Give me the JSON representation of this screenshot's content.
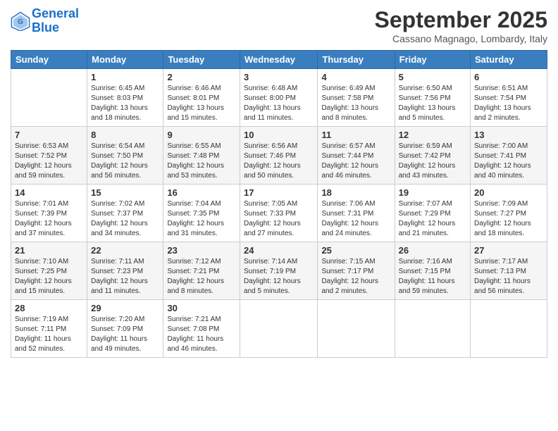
{
  "header": {
    "logo_line1": "General",
    "logo_line2": "Blue",
    "month_title": "September 2025",
    "location": "Cassano Magnago, Lombardy, Italy"
  },
  "days_of_week": [
    "Sunday",
    "Monday",
    "Tuesday",
    "Wednesday",
    "Thursday",
    "Friday",
    "Saturday"
  ],
  "weeks": [
    [
      {
        "day": "",
        "info": ""
      },
      {
        "day": "1",
        "info": "Sunrise: 6:45 AM\nSunset: 8:03 PM\nDaylight: 13 hours\nand 18 minutes."
      },
      {
        "day": "2",
        "info": "Sunrise: 6:46 AM\nSunset: 8:01 PM\nDaylight: 13 hours\nand 15 minutes."
      },
      {
        "day": "3",
        "info": "Sunrise: 6:48 AM\nSunset: 8:00 PM\nDaylight: 13 hours\nand 11 minutes."
      },
      {
        "day": "4",
        "info": "Sunrise: 6:49 AM\nSunset: 7:58 PM\nDaylight: 13 hours\nand 8 minutes."
      },
      {
        "day": "5",
        "info": "Sunrise: 6:50 AM\nSunset: 7:56 PM\nDaylight: 13 hours\nand 5 minutes."
      },
      {
        "day": "6",
        "info": "Sunrise: 6:51 AM\nSunset: 7:54 PM\nDaylight: 13 hours\nand 2 minutes."
      }
    ],
    [
      {
        "day": "7",
        "info": "Sunrise: 6:53 AM\nSunset: 7:52 PM\nDaylight: 12 hours\nand 59 minutes."
      },
      {
        "day": "8",
        "info": "Sunrise: 6:54 AM\nSunset: 7:50 PM\nDaylight: 12 hours\nand 56 minutes."
      },
      {
        "day": "9",
        "info": "Sunrise: 6:55 AM\nSunset: 7:48 PM\nDaylight: 12 hours\nand 53 minutes."
      },
      {
        "day": "10",
        "info": "Sunrise: 6:56 AM\nSunset: 7:46 PM\nDaylight: 12 hours\nand 50 minutes."
      },
      {
        "day": "11",
        "info": "Sunrise: 6:57 AM\nSunset: 7:44 PM\nDaylight: 12 hours\nand 46 minutes."
      },
      {
        "day": "12",
        "info": "Sunrise: 6:59 AM\nSunset: 7:42 PM\nDaylight: 12 hours\nand 43 minutes."
      },
      {
        "day": "13",
        "info": "Sunrise: 7:00 AM\nSunset: 7:41 PM\nDaylight: 12 hours\nand 40 minutes."
      }
    ],
    [
      {
        "day": "14",
        "info": "Sunrise: 7:01 AM\nSunset: 7:39 PM\nDaylight: 12 hours\nand 37 minutes."
      },
      {
        "day": "15",
        "info": "Sunrise: 7:02 AM\nSunset: 7:37 PM\nDaylight: 12 hours\nand 34 minutes."
      },
      {
        "day": "16",
        "info": "Sunrise: 7:04 AM\nSunset: 7:35 PM\nDaylight: 12 hours\nand 31 minutes."
      },
      {
        "day": "17",
        "info": "Sunrise: 7:05 AM\nSunset: 7:33 PM\nDaylight: 12 hours\nand 27 minutes."
      },
      {
        "day": "18",
        "info": "Sunrise: 7:06 AM\nSunset: 7:31 PM\nDaylight: 12 hours\nand 24 minutes."
      },
      {
        "day": "19",
        "info": "Sunrise: 7:07 AM\nSunset: 7:29 PM\nDaylight: 12 hours\nand 21 minutes."
      },
      {
        "day": "20",
        "info": "Sunrise: 7:09 AM\nSunset: 7:27 PM\nDaylight: 12 hours\nand 18 minutes."
      }
    ],
    [
      {
        "day": "21",
        "info": "Sunrise: 7:10 AM\nSunset: 7:25 PM\nDaylight: 12 hours\nand 15 minutes."
      },
      {
        "day": "22",
        "info": "Sunrise: 7:11 AM\nSunset: 7:23 PM\nDaylight: 12 hours\nand 11 minutes."
      },
      {
        "day": "23",
        "info": "Sunrise: 7:12 AM\nSunset: 7:21 PM\nDaylight: 12 hours\nand 8 minutes."
      },
      {
        "day": "24",
        "info": "Sunrise: 7:14 AM\nSunset: 7:19 PM\nDaylight: 12 hours\nand 5 minutes."
      },
      {
        "day": "25",
        "info": "Sunrise: 7:15 AM\nSunset: 7:17 PM\nDaylight: 12 hours\nand 2 minutes."
      },
      {
        "day": "26",
        "info": "Sunrise: 7:16 AM\nSunset: 7:15 PM\nDaylight: 11 hours\nand 59 minutes."
      },
      {
        "day": "27",
        "info": "Sunrise: 7:17 AM\nSunset: 7:13 PM\nDaylight: 11 hours\nand 56 minutes."
      }
    ],
    [
      {
        "day": "28",
        "info": "Sunrise: 7:19 AM\nSunset: 7:11 PM\nDaylight: 11 hours\nand 52 minutes."
      },
      {
        "day": "29",
        "info": "Sunrise: 7:20 AM\nSunset: 7:09 PM\nDaylight: 11 hours\nand 49 minutes."
      },
      {
        "day": "30",
        "info": "Sunrise: 7:21 AM\nSunset: 7:08 PM\nDaylight: 11 hours\nand 46 minutes."
      },
      {
        "day": "",
        "info": ""
      },
      {
        "day": "",
        "info": ""
      },
      {
        "day": "",
        "info": ""
      },
      {
        "day": "",
        "info": ""
      }
    ]
  ]
}
